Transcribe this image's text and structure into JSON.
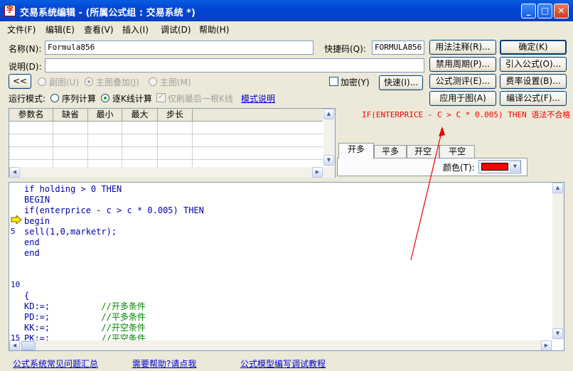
{
  "window": {
    "title": "交易系统编辑 - (所属公式组 : 交易系统 *)",
    "icon_glyph": "字"
  },
  "menu": [
    "文件(F)",
    "编辑(E)",
    "查看(V)",
    "插入(I)",
    "调试(D)",
    "帮助(H)"
  ],
  "form": {
    "name_label": "名称(N):",
    "name_value": "Formula856",
    "shortcut_label": "快捷码(Q):",
    "shortcut_value": "FORMULA856",
    "desc_label": "说明(D):",
    "desc_value": ""
  },
  "right_buttons": [
    [
      "用法注释(R)...",
      "确定(K)"
    ],
    [
      "禁用周期(P)...",
      "引入公式(O)..."
    ],
    [
      "公式测评(E)...",
      "费率设置(B)..."
    ],
    [
      "应用于图(A)",
      "编译公式(F)..."
    ]
  ],
  "chart_mode": {
    "collapse": "<<",
    "options": [
      "副图(U)",
      "主图叠加(J)",
      "主图(M)"
    ],
    "selected": 1,
    "encrypt_label": "加密(Y)",
    "quick_button": "快速(I)..."
  },
  "run_mode": {
    "label": "运行模式:",
    "options": [
      "序列计算",
      "逐K线计算"
    ],
    "selected": 1,
    "last_bar_label": "仅刷最后一根K线",
    "link": "模式说明"
  },
  "param_table": {
    "headers": [
      "参数名",
      "缺省",
      "最小",
      "最大",
      "步长"
    ]
  },
  "error_message": "IF(ENTERPRICE - C > C * 0.005) THEN 语法不合格",
  "tabs": [
    "开多",
    "平多",
    "开空",
    "平空"
  ],
  "active_tab": 0,
  "color": {
    "label": "颜色(T):",
    "value": "#ff0000"
  },
  "editor": {
    "lines": [
      {
        "text": "if holding > 0 THEN",
        "type": "kw"
      },
      {
        "text": "BEGIN",
        "type": "kw"
      },
      {
        "text": "if(enterprice - c > c * 0.005) THEN",
        "type": "kw"
      },
      {
        "text": "begin",
        "type": "kw"
      },
      {
        "text": "sell(1,0,marketr);",
        "type": "normal"
      },
      {
        "text": "end",
        "type": "kw"
      },
      {
        "text": "end",
        "type": "kw"
      },
      {
        "text": "",
        "type": "normal"
      },
      {
        "text": "",
        "type": "normal"
      },
      {
        "text": "",
        "type": "normal"
      },
      {
        "text": "{",
        "type": "normal"
      },
      {
        "text": "KD:=;          //开多条件",
        "type": "mix"
      },
      {
        "text": "PD:=;          //平多条件",
        "type": "mix"
      },
      {
        "text": "KK:=;          //开空条件",
        "type": "mix"
      },
      {
        "text": "PK:=;          //平空条件",
        "type": "mix"
      }
    ],
    "line_numbers": [
      "5",
      "10",
      "15"
    ]
  },
  "footer_links": [
    "公式系统常见问题汇总",
    "需要帮助?请点我",
    "公式模型编写调试教程"
  ]
}
